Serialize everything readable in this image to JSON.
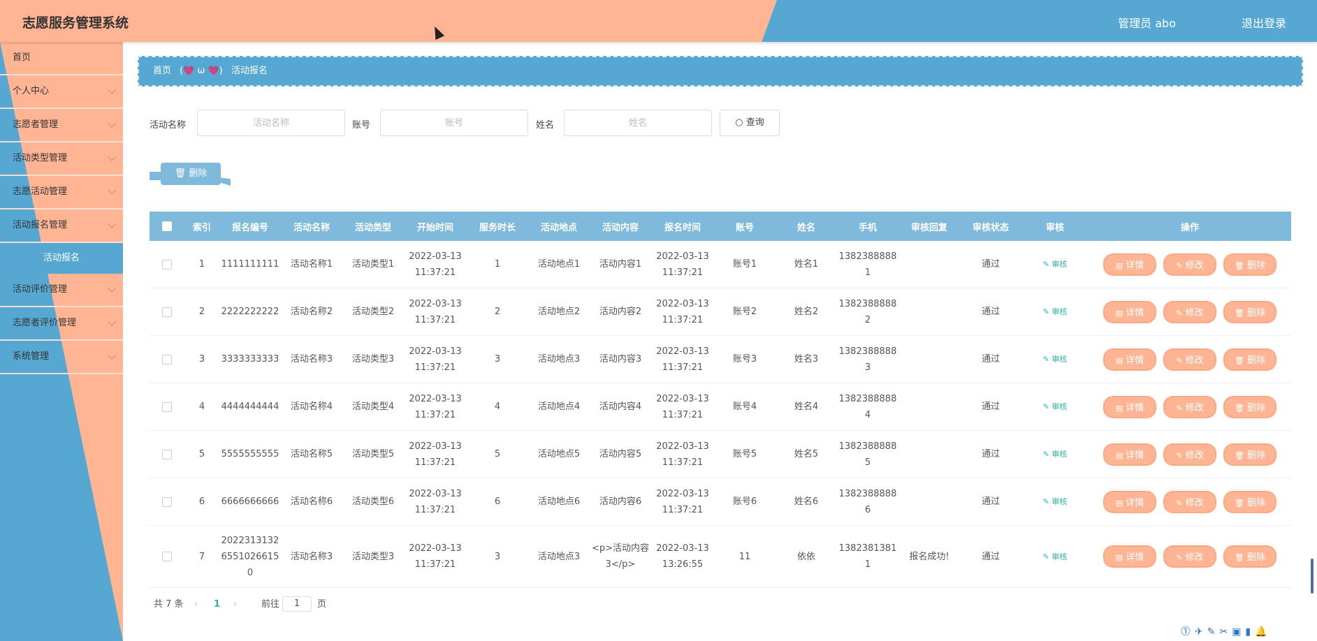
{
  "header": {
    "title": "志愿服务管理系统",
    "user": "管理员 abo",
    "logout": "退出登录"
  },
  "sidebar": {
    "items": [
      {
        "label": "首页",
        "arrow": false
      },
      {
        "label": "个人中心",
        "arrow": true
      },
      {
        "label": "志愿者管理",
        "arrow": true
      },
      {
        "label": "活动类型管理",
        "arrow": true
      },
      {
        "label": "志愿活动管理",
        "arrow": true
      },
      {
        "label": "活动报名管理",
        "arrow": true
      }
    ],
    "active_sub": "活动报名",
    "items_after": [
      {
        "label": "活动评价管理"
      },
      {
        "label": "志愿者评价管理"
      },
      {
        "label": "系统管理"
      }
    ]
  },
  "breadcrumb": {
    "home": "首页",
    "separator": "(💗 ω 💗)",
    "current": "活动报名"
  },
  "search": {
    "activity_label": "活动名称",
    "activity_placeholder": "活动名称",
    "account_label": "账号",
    "account_placeholder": "账号",
    "name_label": "姓名",
    "name_placeholder": "姓名",
    "query_button": "查询"
  },
  "batch_delete": "删除",
  "table": {
    "columns": [
      "索引",
      "报名编号",
      "活动名称",
      "活动类型",
      "开始时间",
      "服务时长",
      "活动地点",
      "活动内容",
      "报名时间",
      "账号",
      "姓名",
      "手机",
      "审核回复",
      "审核状态",
      "审核",
      "操作"
    ],
    "audit_label": "审核",
    "detail_label": "详情",
    "edit_label": "修改",
    "delete_label": "删除",
    "rows": [
      {
        "index": "1",
        "code": "1111111111",
        "activity": "活动名称1",
        "type": "活动类型1",
        "start": "2022-03-13 11:37:21",
        "duration": "1",
        "place": "活动地点1",
        "content": "活动内容1",
        "signup": "2022-03-13 11:37:21",
        "account": "账号1",
        "name": "姓名1",
        "phone": "13823888881",
        "reply": "",
        "status": "通过"
      },
      {
        "index": "2",
        "code": "2222222222",
        "activity": "活动名称2",
        "type": "活动类型2",
        "start": "2022-03-13 11:37:21",
        "duration": "2",
        "place": "活动地点2",
        "content": "活动内容2",
        "signup": "2022-03-13 11:37:21",
        "account": "账号2",
        "name": "姓名2",
        "phone": "13823888882",
        "reply": "",
        "status": "通过"
      },
      {
        "index": "3",
        "code": "3333333333",
        "activity": "活动名称3",
        "type": "活动类型3",
        "start": "2022-03-13 11:37:21",
        "duration": "3",
        "place": "活动地点3",
        "content": "活动内容3",
        "signup": "2022-03-13 11:37:21",
        "account": "账号3",
        "name": "姓名3",
        "phone": "13823888883",
        "reply": "",
        "status": "通过"
      },
      {
        "index": "4",
        "code": "4444444444",
        "activity": "活动名称4",
        "type": "活动类型4",
        "start": "2022-03-13 11:37:21",
        "duration": "4",
        "place": "活动地点4",
        "content": "活动内容4",
        "signup": "2022-03-13 11:37:21",
        "account": "账号4",
        "name": "姓名4",
        "phone": "13823888884",
        "reply": "",
        "status": "通过"
      },
      {
        "index": "5",
        "code": "5555555555",
        "activity": "活动名称5",
        "type": "活动类型5",
        "start": "2022-03-13 11:37:21",
        "duration": "5",
        "place": "活动地点5",
        "content": "活动内容5",
        "signup": "2022-03-13 11:37:21",
        "account": "账号5",
        "name": "姓名5",
        "phone": "13823888885",
        "reply": "",
        "status": "通过"
      },
      {
        "index": "6",
        "code": "6666666666",
        "activity": "活动名称6",
        "type": "活动类型6",
        "start": "2022-03-13 11:37:21",
        "duration": "6",
        "place": "活动地点6",
        "content": "活动内容6",
        "signup": "2022-03-13 11:37:21",
        "account": "账号6",
        "name": "姓名6",
        "phone": "13823888886",
        "reply": "",
        "status": "通过"
      },
      {
        "index": "7",
        "code": "202231313265510266150",
        "activity": "活动名称3",
        "type": "活动类型3",
        "start": "2022-03-13 11:37:21",
        "duration": "3",
        "place": "活动地点3",
        "content": "<p>活动内容3</p>",
        "signup": "2022-03-13 13:26:55",
        "account": "11",
        "name": "依依",
        "phone": "13823813811",
        "reply": "报名成功!",
        "status": "通过"
      }
    ]
  },
  "pagination": {
    "total": "共 7 条",
    "current_page": "1",
    "goto_label": "前往",
    "goto_value": "1",
    "page_suffix": "页"
  },
  "colors": {
    "peach": "#ffb594",
    "blue": "#56a8d3",
    "table_header": "#7fb9dc",
    "audit_green": "#2bb5a5"
  }
}
